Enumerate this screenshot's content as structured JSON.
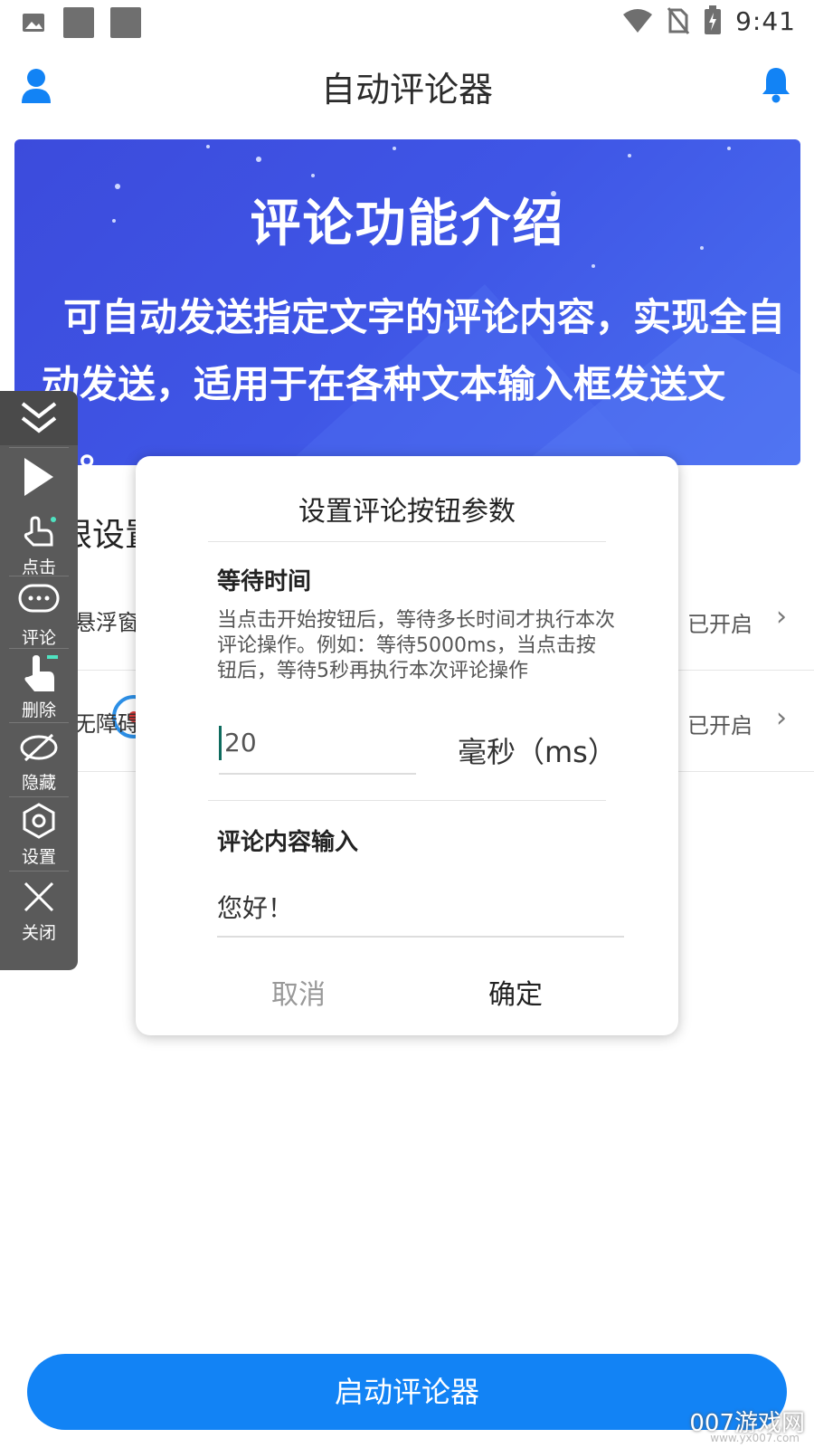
{
  "status_bar": {
    "time": "9:41"
  },
  "header": {
    "title": "自动评论器"
  },
  "banner": {
    "title": "评论功能介绍",
    "text": "可自动发送指定文字的评论内容，实现全自动发送，适用于在各种文本输入框发送文字。"
  },
  "permissions": {
    "title": "权限设置",
    "items": [
      {
        "label": "悬浮窗",
        "status": "已开启"
      },
      {
        "label": "无障碍",
        "status": "已开启"
      }
    ]
  },
  "floating_toolbar": {
    "items": [
      {
        "label": "点击",
        "icon": "finger-tap-icon"
      },
      {
        "label": "评论",
        "icon": "comment-bubble-icon"
      },
      {
        "label": "删除",
        "icon": "hand-pointer-icon"
      },
      {
        "label": "隐藏",
        "icon": "eye-hidden-icon"
      },
      {
        "label": "设置",
        "icon": "settings-icon"
      },
      {
        "label": "关闭",
        "icon": "close-icon"
      }
    ]
  },
  "dialog": {
    "title": "设置评论按钮参数",
    "wait_section_title": "等待时间",
    "wait_description": "当点击开始按钮后，等待多长时间才执行本次评论操作。例如：等待5000ms，当点击按钮后，等待5秒再执行本次评论操作",
    "wait_value": "20",
    "wait_unit": "毫秒（ms）",
    "content_section_title": "评论内容输入",
    "content_value": "您好！",
    "cancel_label": "取消",
    "confirm_label": "确定"
  },
  "bottom": {
    "start_button": "启动评论器"
  },
  "watermark": {
    "main": "007游戏网",
    "sub": "www.yx007.com"
  },
  "colors": {
    "accent": "#1283f5",
    "banner": "#3f56e6",
    "toolbar": "#5a5a5a"
  }
}
